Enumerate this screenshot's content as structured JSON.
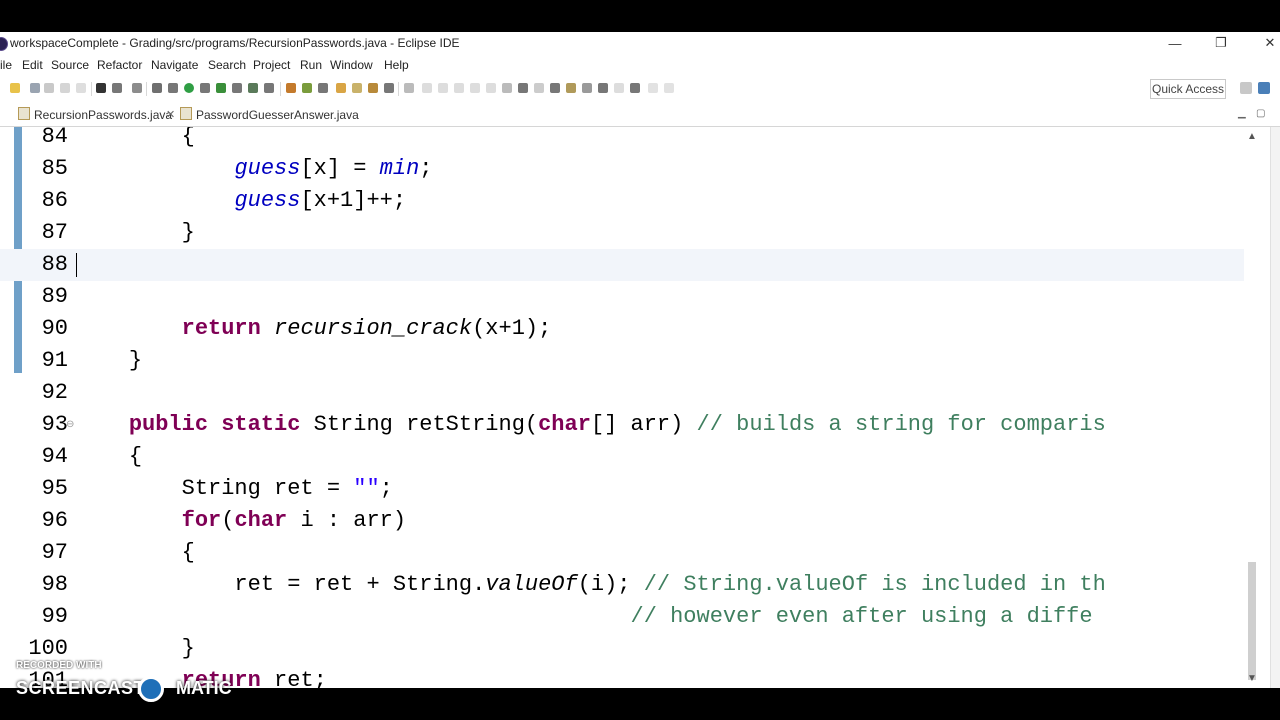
{
  "window": {
    "title": "workspaceComplete - Grading/src/programs/RecursionPasswords.java - Eclipse IDE",
    "controls": {
      "minimize": "—",
      "restore": "❐",
      "close": "✕"
    }
  },
  "menu": {
    "items": [
      "ile",
      "Edit",
      "Source",
      "Refactor",
      "Navigate",
      "Search",
      "Project",
      "Run",
      "Window",
      "Help"
    ]
  },
  "toolbar": {
    "quick_access": "Quick Access"
  },
  "tabs": [
    {
      "label": "RecursionPasswords.java",
      "close": "✕",
      "active": true
    },
    {
      "label": "PasswordGuesserAnswer.java",
      "active": false
    }
  ],
  "editor": {
    "current_line": 88,
    "lines": [
      {
        "num": "84",
        "text": "{"
      },
      {
        "num": "85",
        "text": "guess[x] = min;"
      },
      {
        "num": "86",
        "text": "guess[x+1]++;"
      },
      {
        "num": "87",
        "text": "}"
      },
      {
        "num": "88",
        "text": ""
      },
      {
        "num": "89",
        "text": ""
      },
      {
        "num": "90",
        "text": "return recursion_crack(x+1);"
      },
      {
        "num": "91",
        "text": "}"
      },
      {
        "num": "92",
        "text": ""
      },
      {
        "num": "93",
        "text": "public static String retString(char[] arr) // builds a string for comparis"
      },
      {
        "num": "94",
        "text": "{"
      },
      {
        "num": "95",
        "text": "String ret = \"\";"
      },
      {
        "num": "96",
        "text": "for(char i : arr)"
      },
      {
        "num": "97",
        "text": "{"
      },
      {
        "num": "98",
        "text": "ret = ret + String.valueOf(i); // String.valueOf is included in th"
      },
      {
        "num": "99",
        "text": "// however even after using a diffe"
      },
      {
        "num": "100",
        "text": "}"
      },
      {
        "num": "101",
        "text": "return ret;"
      }
    ]
  },
  "watermark": {
    "small": "RECORDED WITH",
    "brand_left": "SCREENCAST",
    "brand_right": "MATIC"
  },
  "colors": {
    "keyword": "#7f0055",
    "field": "#0000c0",
    "comment": "#3f7f5f",
    "string": "#2a00ff"
  }
}
